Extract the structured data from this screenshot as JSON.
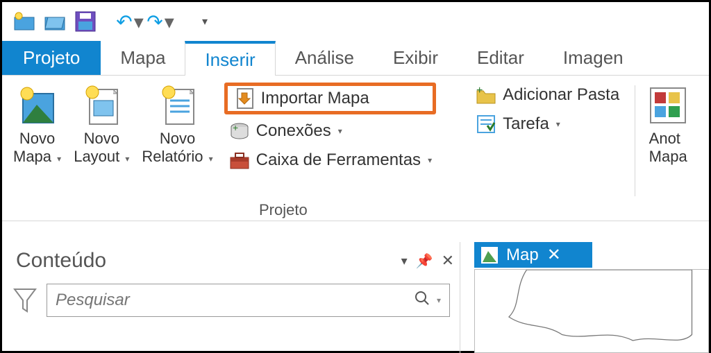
{
  "qat": {
    "icons": [
      "new-project-icon",
      "open-project-icon",
      "save-icon",
      "undo-icon",
      "redo-icon",
      "customize-icon"
    ]
  },
  "tabs": {
    "projeto": "Projeto",
    "items": [
      "Mapa",
      "Inserir",
      "Análise",
      "Exibir",
      "Editar",
      "Imagen"
    ],
    "active_index": 1
  },
  "ribbon": {
    "novo_mapa": "Novo\nMapa",
    "novo_layout": "Novo\nLayout",
    "novo_relatorio": "Novo\nRelatório",
    "importar_mapa": "Importar Mapa",
    "conexoes": "Conexões",
    "caixa_ferramentas": "Caixa de Ferramentas",
    "adicionar_pasta": "Adicionar Pasta",
    "tarefa": "Tarefa",
    "group_label": "Projeto",
    "anotacao_line1": "Anot",
    "anotacao_line2": "Mapa"
  },
  "contents": {
    "title": "Conteúdo",
    "search_placeholder": "Pesquisar"
  },
  "map": {
    "tab_label": "Map"
  }
}
